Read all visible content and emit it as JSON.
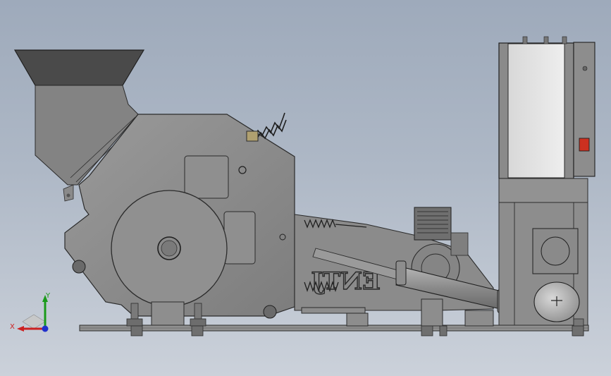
{
  "viewport": {
    "background_top": "#9eaabb",
    "background_bottom": "#cbd1da"
  },
  "model": {
    "body_color": "#8c8c8c",
    "body_dark": "#5a5a5a",
    "edge_color": "#2b2b2b",
    "cabinet_door_color": "#e6e6e6",
    "hopper_color": "#4a4a4a",
    "mirrored_text": "ENTJ"
  },
  "triad": {
    "x_label": "X",
    "y_label": "Y",
    "x_color": "#cc2020",
    "y_color": "#1a9a1a",
    "z_color": "#2030cc",
    "icon": "coordinate-triad-icon"
  }
}
